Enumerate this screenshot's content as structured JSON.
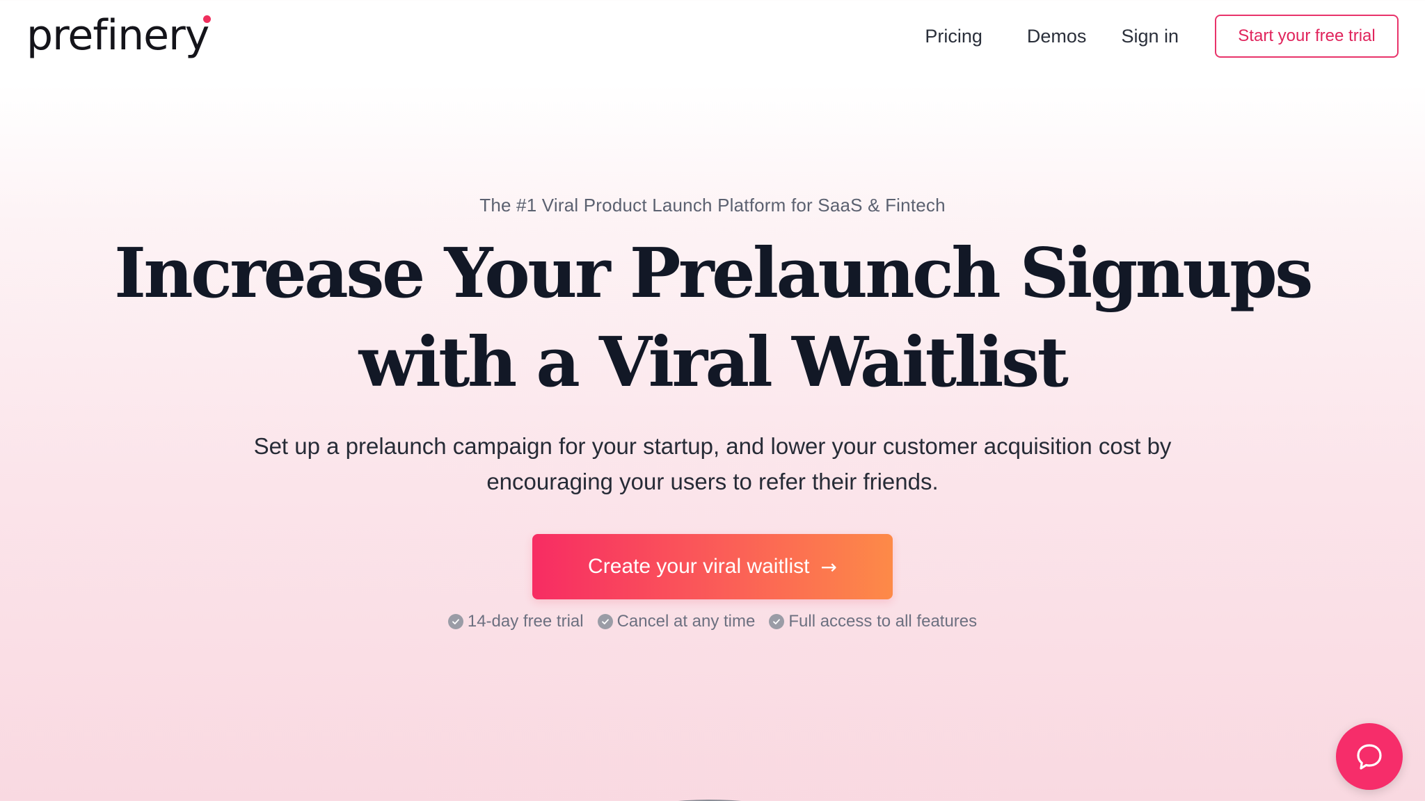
{
  "brand": {
    "logo_text": "prefinery",
    "accent_color": "#ef2f5d"
  },
  "nav": {
    "pricing": "Pricing",
    "demos": "Demos",
    "sign_in": "Sign in",
    "cta": "Start your free trial"
  },
  "hero": {
    "eyebrow": "The #1 Viral Product Launch Platform for SaaS & Fintech",
    "headline_line1": "Increase Your Prelaunch Signups",
    "headline_line2": "with a Viral Waitlist",
    "subhead_line1": "Set up a prelaunch campaign for your startup, and lower your customer acquisition cost by",
    "subhead_line2": "encouraging your users to refer their friends.",
    "cta_label": "Create your viral waitlist",
    "cta_arrow": "→",
    "cta_gradient": [
      "#f72c63",
      "#fd8a48"
    ]
  },
  "features": [
    {
      "icon": "check-circle-icon",
      "label": "14-day free trial"
    },
    {
      "icon": "check-circle-icon",
      "label": "Cancel at any time"
    },
    {
      "icon": "check-circle-icon",
      "label": "Full access to all features"
    }
  ],
  "chat": {
    "icon": "chat-bubble-icon",
    "color": "#f62d6a"
  }
}
